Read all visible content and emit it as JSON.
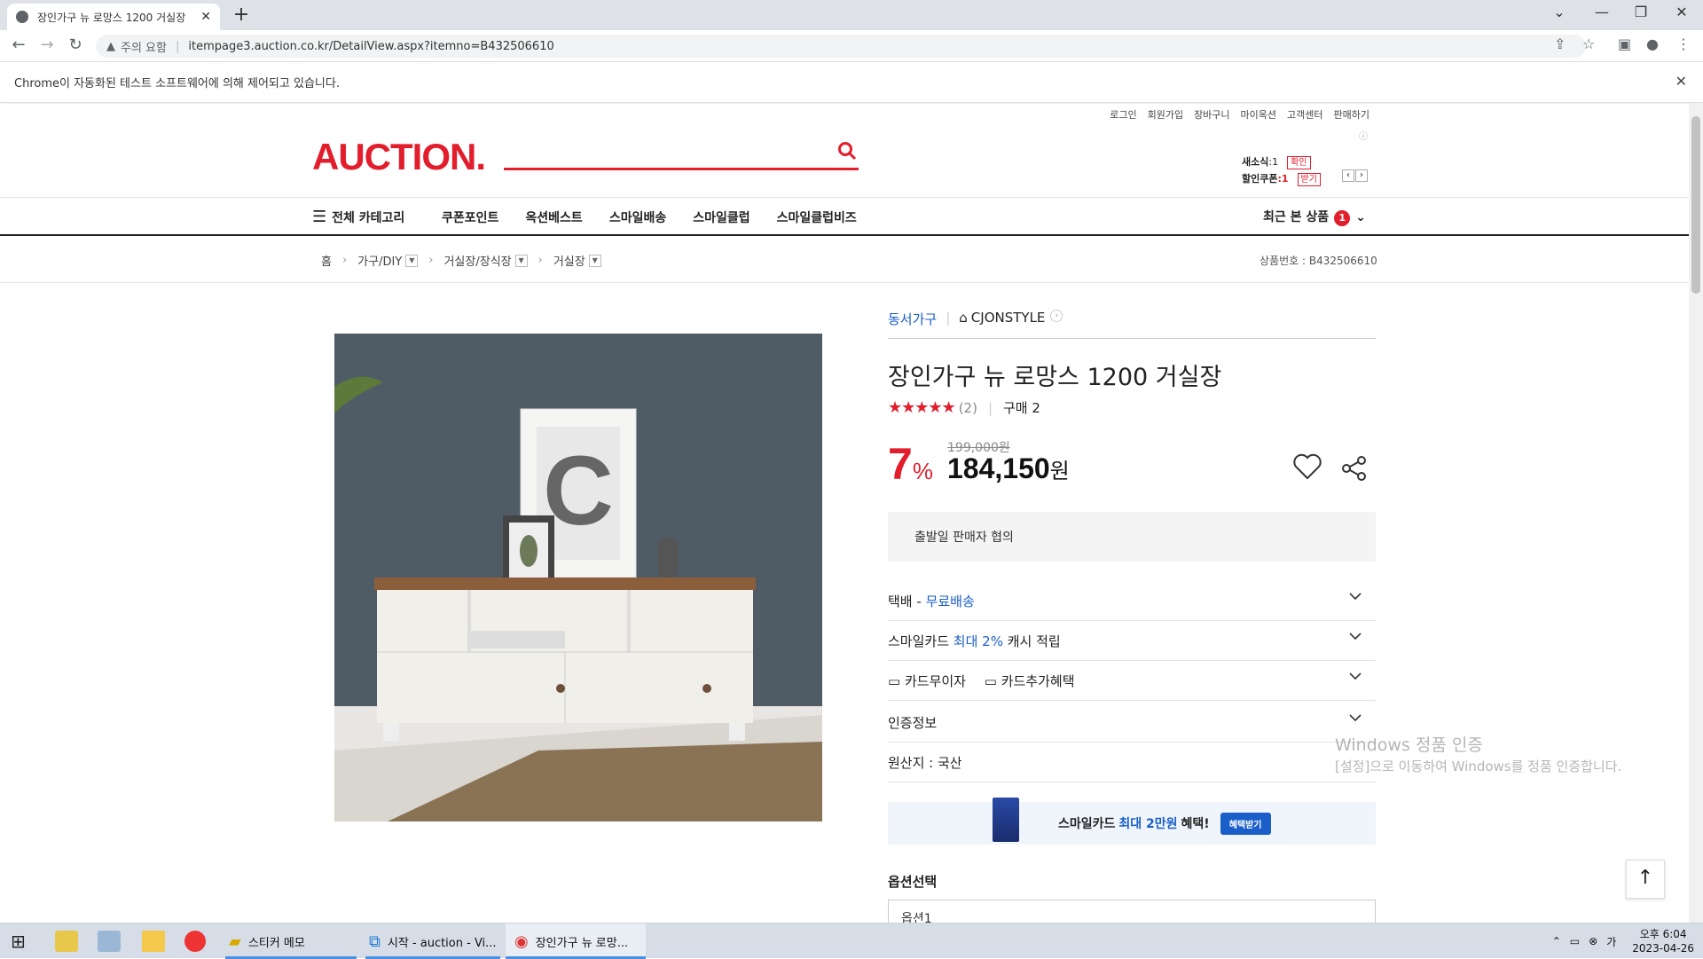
{
  "browser": {
    "tab_title": "장인가구 뉴 로망스 1200 거실장",
    "tab_close": "✕",
    "new_tab": "+",
    "security_label": "주의 요함",
    "url": "itempage3.auction.co.kr/DetailView.aspx?itemno=B432506610",
    "infobar_text": "Chrome이 자동화된 테스트 소프트웨어에 의해 제어되고 있습니다."
  },
  "header": {
    "top_links": [
      "로그인",
      "회원가입",
      "장바구니",
      "마이옥션",
      "고객센터",
      "판매하기"
    ],
    "logo": "AUCTION.",
    "notification_label": "새소식",
    "notification_count": ":1",
    "notification_action": "확인",
    "coupon_label": "할인쿠폰",
    "coupon_count": ":1",
    "coupon_action": "받기"
  },
  "gnb": {
    "category_button": "전체 카테고리",
    "menu": [
      "쿠폰포인트",
      "옥션베스트",
      "스마일배송",
      "스마일클럽",
      "스마일클럽비즈"
    ],
    "recent_label": "최근 본 상품",
    "recent_count": "1"
  },
  "breadcrumb": {
    "items": [
      "홈",
      "가구/DIY",
      "거실장/장식장",
      "거실장"
    ],
    "product_number": "상품번호 : B432506610"
  },
  "product": {
    "seller": "동서가구",
    "store": "CJONSTYLE",
    "title": "장인가구 뉴 로망스 1200 거실장",
    "stars": "★★★★★",
    "rating_value": 5,
    "review_count": "(2)",
    "purchase_count": "구매 2",
    "discount_number": "7",
    "discount_symbol": "%",
    "original_price": "199,000원",
    "sale_price": "184,150",
    "currency": "원",
    "ship_date": "출발일 판매자 협의",
    "delivery_prefix": "택배 - ",
    "delivery_value": "무료배송",
    "smilecard_prefix": "스마일카드 ",
    "smilecard_highlight": "최대 2%",
    "smilecard_suffix": " 캐시 적립",
    "card_interest": "카드무이자",
    "card_benefit": "카드추가혜택",
    "certification": "인증정보",
    "origin": "원산지 : 국산"
  },
  "banner": {
    "text_prefix": "스마일카드",
    "highlight": "최대 2만원",
    "text_suffix": "혜택!",
    "button": "혜택받기"
  },
  "options": {
    "heading": "옵션선택",
    "select_value": "옵션1"
  },
  "watermark": {
    "title": "Windows 정품 인증",
    "subtitle": "[설정]으로 이동하여 Windows를 정품 인증합니다."
  },
  "taskbar": {
    "apps": [
      "스티커 메모",
      "시작 - auction - Vi...",
      "장인가구 뉴 로망..."
    ],
    "time_period": "오후 6:04",
    "date": "2023-04-26"
  },
  "colors": {
    "brand_red": "#e21d2c",
    "link_blue": "#1a5ec9"
  }
}
